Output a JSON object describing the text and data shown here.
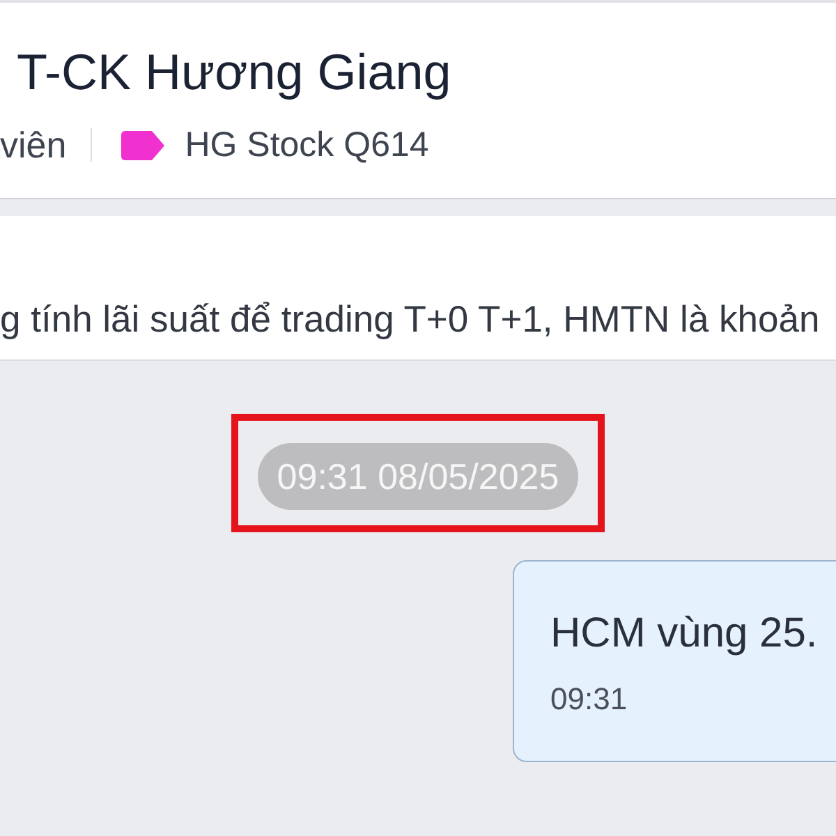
{
  "header": {
    "title": "T-CK Hương Giang",
    "subtitle": "viên",
    "tag": {
      "label": "HG Stock Q614",
      "color": "#f030cf"
    }
  },
  "pinned_message": {
    "text": "g tính lãi suất để trading T+0 T+1, HMTN là khoản"
  },
  "messages": [
    {
      "kind": "date",
      "text": "09:31 08/05/2025",
      "highlighted": true
    },
    {
      "kind": "outgoing",
      "text": "HCM vùng 25.",
      "time": "09:31"
    }
  ]
}
